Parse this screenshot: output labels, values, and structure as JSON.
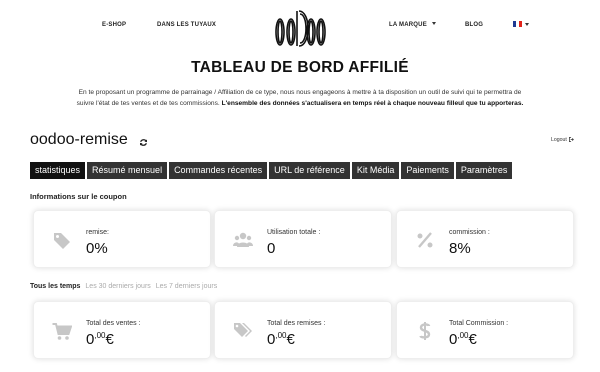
{
  "nav": {
    "eshop": "E-SHOP",
    "tuyaux": "DANS LES TUYAUX",
    "marque": "LA MARQUE",
    "blog": "BLOG",
    "flag_colors": [
      "#1f3a93",
      "#ffffff",
      "#e2231a"
    ]
  },
  "page": {
    "title": "TABLEAU DE BORD AFFILIÉ",
    "intro_line1": "En te proposant un programme de parrainage / Affiliation de ce type, nous nous engageons à mettre à ta disposition un outil de suivi qui te permettra de",
    "intro_line2": "suivre l'état de tes ventes et de tes commissions.",
    "intro_bold": "L'ensemble des données s'actualisera en temps réel à chaque nouveau filleul que tu apporteras."
  },
  "account": {
    "name": "oodoo-remise",
    "logout": "Logout"
  },
  "tabs": [
    "statistiques",
    "Résumé mensuel",
    "Commandes récentes",
    "URL de référence",
    "Kit Média",
    "Paiements",
    "Paramètres"
  ],
  "coupon": {
    "title": "Informations sur le coupon",
    "cards": [
      {
        "icon": "tag-icon",
        "label": "remise:",
        "value": "0%"
      },
      {
        "icon": "users-icon",
        "label": "Utilisation totale :",
        "value": "0"
      },
      {
        "icon": "percent-icon",
        "label": "commission :",
        "value": "8%"
      }
    ]
  },
  "totals": {
    "filters": [
      "Tous les temps",
      "Les 30 derniers jours",
      "Les 7 derniers jours"
    ],
    "cards": [
      {
        "icon": "cart-icon",
        "label": "Total des ventes :",
        "int": "0",
        "dec": ",00",
        "cur": "€"
      },
      {
        "icon": "tags-icon",
        "label": "Total des remises :",
        "int": "0",
        "dec": ",00",
        "cur": "€"
      },
      {
        "icon": "dollar-icon",
        "label": "Total Commission :",
        "int": "0",
        "dec": ",00",
        "cur": "€"
      }
    ]
  }
}
